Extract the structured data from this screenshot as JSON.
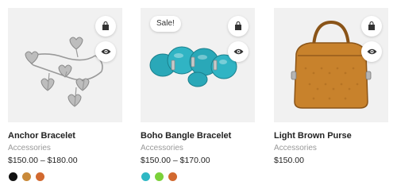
{
  "products": [
    {
      "name": "Anchor Bracelet",
      "category": "Accessories",
      "price": "$150.00 – $180.00",
      "sale": "",
      "image": "silver-heart-charm-bracelet",
      "swatches": [
        "#111111",
        "#c98a3a",
        "#d2692f"
      ]
    },
    {
      "name": "Boho Bangle Bracelet",
      "category": "Accessories",
      "price": "$150.00 – $170.00",
      "sale": "Sale!",
      "image": "turquoise-bangle-bracelet",
      "swatches": [
        "#2fb8c4",
        "#7bd13a",
        "#d2692f"
      ]
    },
    {
      "name": "Light Brown Purse",
      "category": "Accessories",
      "price": "$150.00",
      "sale": "",
      "image": "light-brown-purse",
      "swatches": []
    }
  ],
  "icons": {
    "cart": "shopping-bag-icon",
    "view": "eye-icon"
  }
}
